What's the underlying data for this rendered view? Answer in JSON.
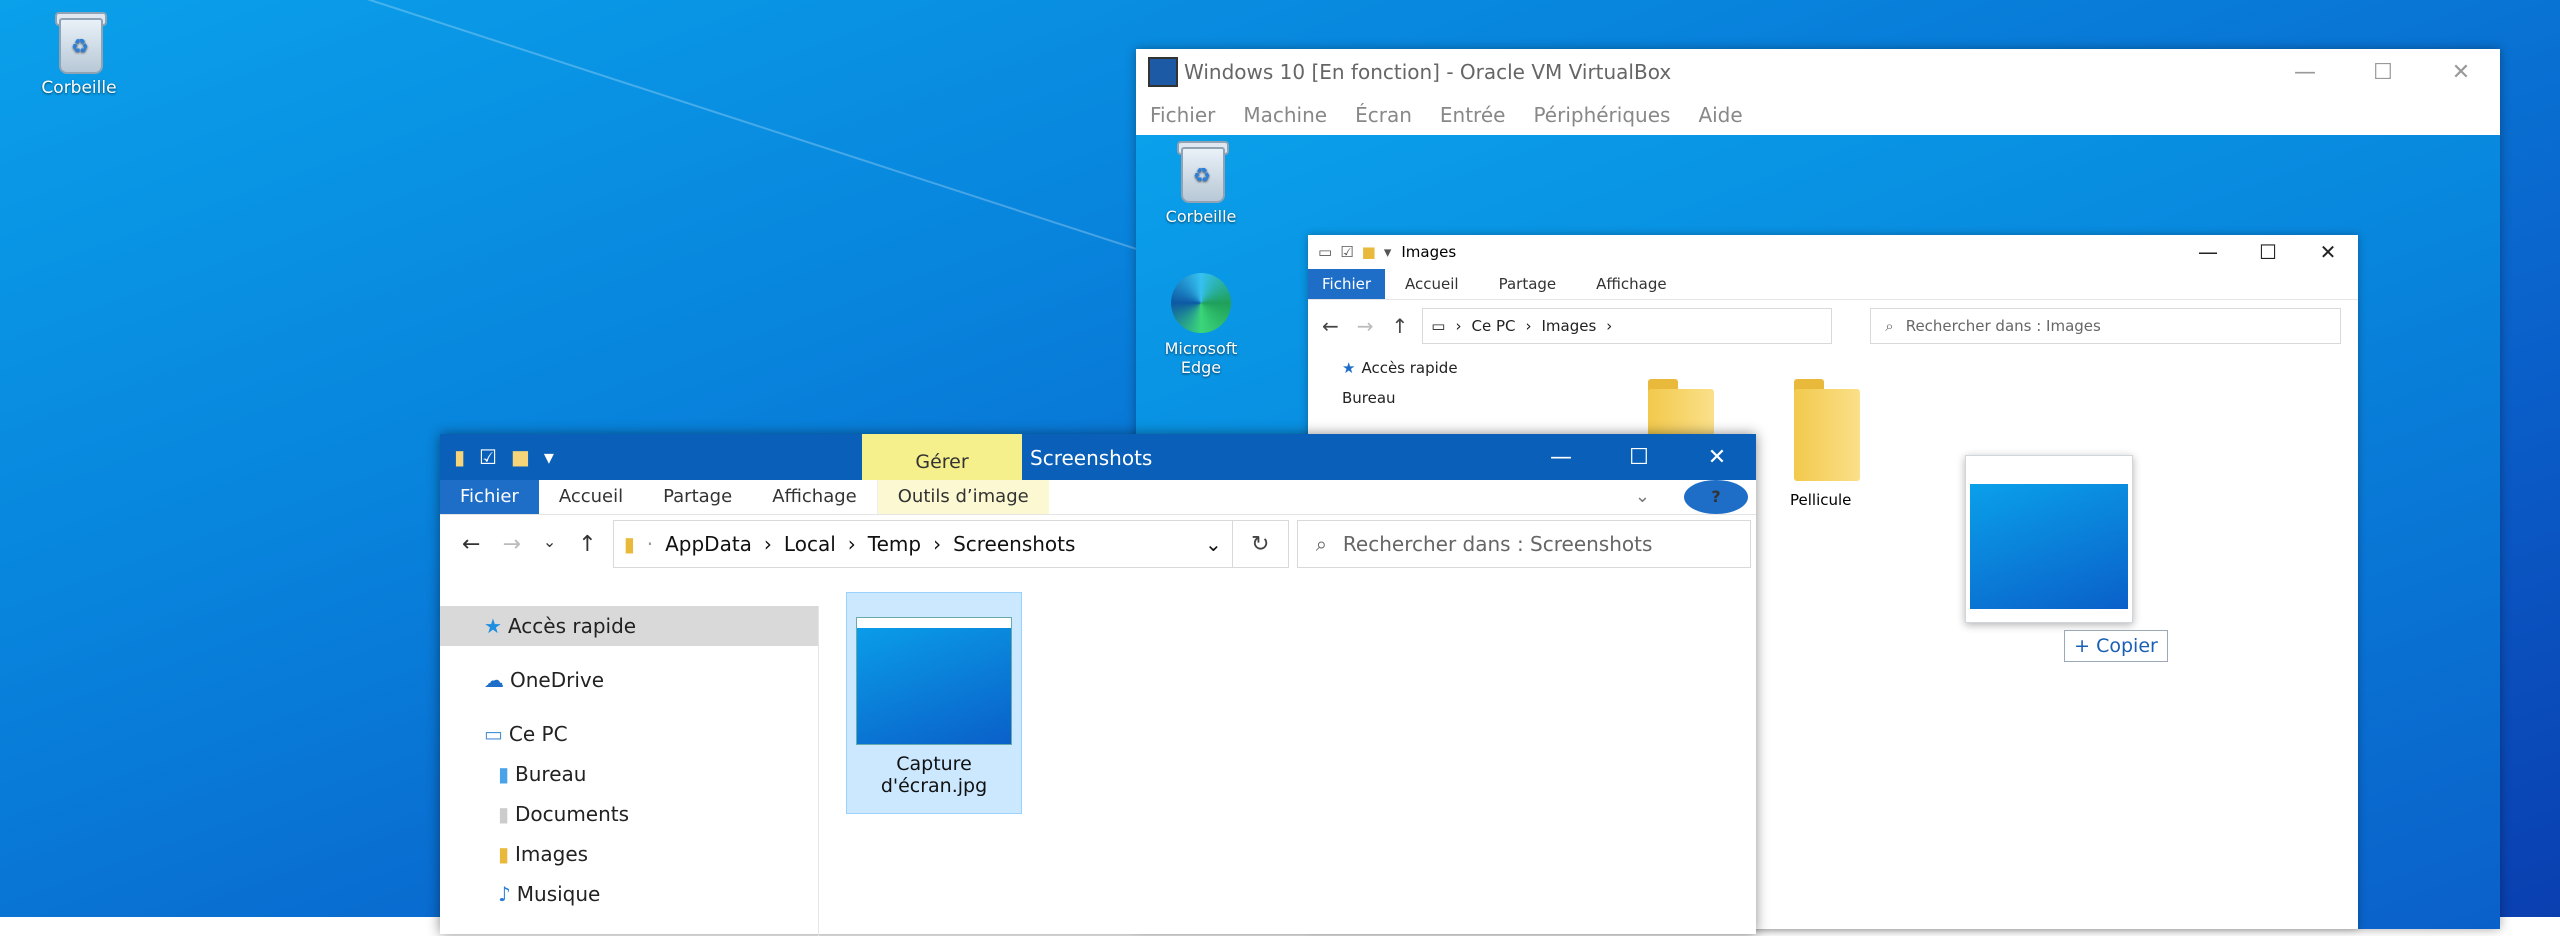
{
  "desktop": {
    "icons": [
      {
        "label": "Corbeille"
      }
    ]
  },
  "vbox": {
    "title": "Windows 10 [En fonction] - Oracle VM VirtualBox",
    "menu": [
      "Fichier",
      "Machine",
      "Écran",
      "Entrée",
      "Périphériques",
      "Aide"
    ],
    "guest_icons": [
      {
        "label": "Corbeille"
      },
      {
        "label": "Microsoft Edge"
      }
    ]
  },
  "inner_explorer": {
    "title": "Images",
    "ribbon": [
      "Fichier",
      "Accueil",
      "Partage",
      "Affichage"
    ],
    "path": [
      "Ce PC",
      "Images"
    ],
    "search_placeholder": "Rechercher dans : Images",
    "nav": [
      "Accès rapide",
      "Bureau"
    ],
    "folders": [
      {
        "label": ""
      },
      {
        "label": "Pellicule"
      }
    ]
  },
  "drag": {
    "copy_label": "Copier"
  },
  "front_explorer": {
    "manage_tab": "Gérer",
    "title": "Screenshots",
    "ribbon": [
      "Fichier",
      "Accueil",
      "Partage",
      "Affichage",
      "Outils d’image"
    ],
    "path": [
      "AppData",
      "Local",
      "Temp",
      "Screenshots"
    ],
    "search_placeholder": "Rechercher dans : Screenshots",
    "nav": [
      "Accès rapide",
      "OneDrive",
      "Ce PC",
      "Bureau",
      "Documents",
      "Images",
      "Musique"
    ],
    "file": {
      "name_line1": "Capture",
      "name_line2": "d'écran.jpg"
    }
  }
}
